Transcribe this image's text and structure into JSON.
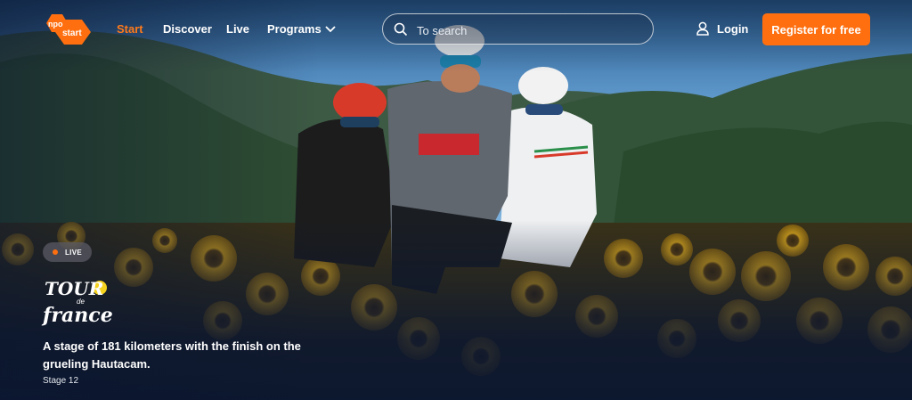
{
  "brand": {
    "logo_text": "npo start",
    "accent": "#ff6f0f"
  },
  "nav": {
    "start": "Start",
    "discover": "Discover",
    "live": "Live",
    "programs": "Programs"
  },
  "search": {
    "placeholder": "To search"
  },
  "account": {
    "login": "Login",
    "register": "Register for free"
  },
  "hero": {
    "badge": "LIVE",
    "program_logo": "Tour de France",
    "description": "A stage of 181 kilometers with the finish on the grueling Hautacam.",
    "subtitle": "Stage 12"
  }
}
